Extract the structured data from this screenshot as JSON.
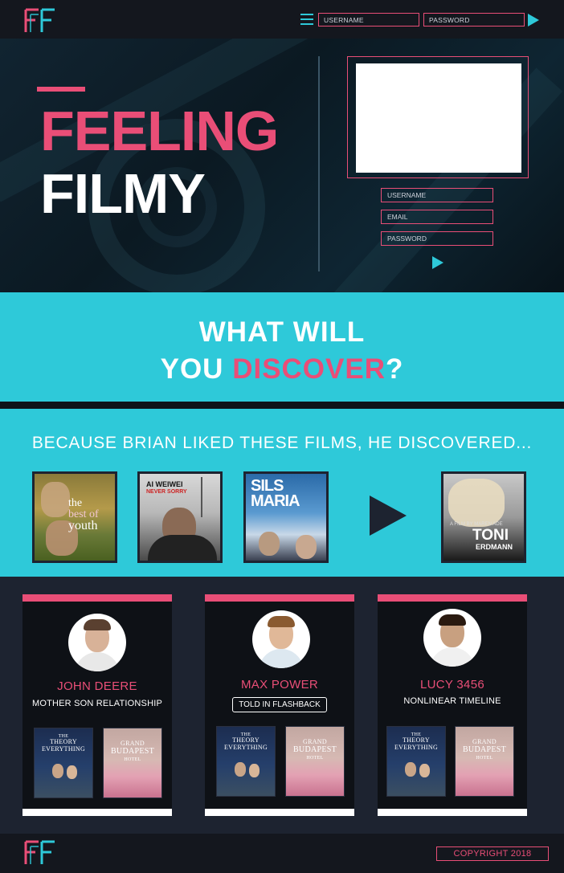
{
  "header": {
    "logo_text": "FF",
    "username_placeholder": "USERNAME",
    "password_placeholder": "PASSWORD"
  },
  "hero": {
    "title_line1": "FEELING",
    "title_line2": "FILMY",
    "username_placeholder": "USERNAME",
    "email_placeholder": "EMAIL",
    "password_placeholder": "PASSWORD"
  },
  "discover": {
    "line1": "WHAT WILL",
    "line2_prefix": "YOU ",
    "line2_highlight": "DISCOVER",
    "line2_suffix": "?"
  },
  "recommendations": {
    "title": "BECAUSE BRIAN LIKED THESE FILMS, HE DISCOVERED...",
    "liked": [
      {
        "title_parts": [
          "the",
          "best of",
          "youth"
        ]
      },
      {
        "title_parts": [
          "AI WEIWEI",
          "NEVER SORRY"
        ]
      },
      {
        "title_parts": [
          "SILS",
          "MARIA"
        ]
      }
    ],
    "discovered": {
      "title_parts": [
        "TONI",
        "ERDMANN",
        "A FILM BY MAREN ADE"
      ]
    }
  },
  "users": [
    {
      "name": "JOHN DEERE",
      "tag": "MOTHER SON RELATIONSHIP",
      "films": [
        {
          "lines": [
            "THE",
            "THEORY",
            "EVERYTHING"
          ]
        },
        {
          "lines": [
            "GRAND",
            "BUDAPEST",
            "HOTEL"
          ]
        }
      ]
    },
    {
      "name": "MAX POWER",
      "tag": "TOLD IN FLASHBACK",
      "films": [
        {
          "lines": [
            "THE",
            "THEORY",
            "EVERYTHING"
          ]
        },
        {
          "lines": [
            "GRAND",
            "BUDAPEST",
            "HOTEL"
          ]
        }
      ]
    },
    {
      "name": "LUCY 3456",
      "tag": "NONLINEAR TIMELINE",
      "films": [
        {
          "lines": [
            "THE",
            "THEORY",
            "EVERYTHING"
          ]
        },
        {
          "lines": [
            "GRAND",
            "BUDAPEST",
            "HOTEL"
          ]
        }
      ]
    }
  ],
  "footer": {
    "logo_text": "FF",
    "copyright": "COPYRIGHT 2018"
  },
  "colors": {
    "accent_pink": "#e94e77",
    "accent_cyan": "#2ec9d9",
    "dark": "#1d2330"
  }
}
